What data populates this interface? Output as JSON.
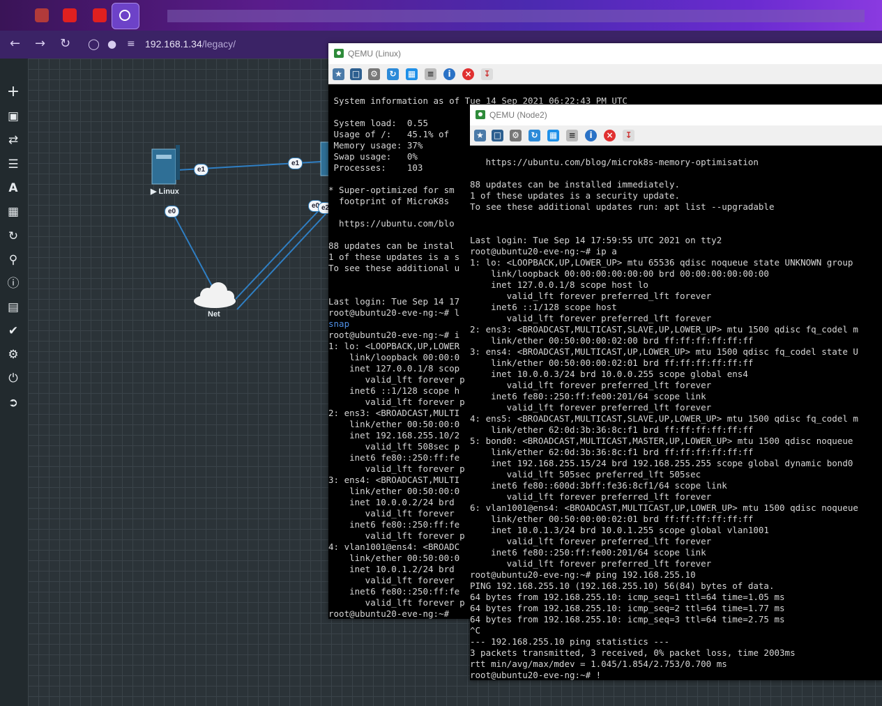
{
  "browser": {
    "url_host": "192.168.1.34",
    "url_path": "/legacy/"
  },
  "sidebar": {
    "icons": [
      "add-icon",
      "node-icon",
      "network-icon",
      "list-icon",
      "text-icon",
      "grid-icon",
      "refresh-icon",
      "zoom-icon",
      "info-icon",
      "table-icon",
      "check-icon",
      "settings-icon",
      "power-icon",
      "logout-icon"
    ]
  },
  "topology": {
    "linux_label": "Linux",
    "net_label": "Net",
    "ports": {
      "linux_e1": "e1",
      "linux_e0": "e0",
      "node2_e1": "e1",
      "node2_e0": "e0",
      "node2_e2": "e2"
    }
  },
  "win_linux": {
    "title": "QEMU (Linux)",
    "lines": [
      "",
      " System information as of Tue 14 Sep 2021 06:22:43 PM UTC",
      "",
      " System load:  0.55",
      " Usage of /:   45.1% of",
      " Memory usage: 37%",
      " Swap usage:   0%",
      " Processes:    103",
      "",
      "* Super-optimized for sm",
      "  footprint of MicroK8s",
      "",
      "  https://ubuntu.com/blo",
      "",
      "88 updates can be instal",
      "1 of these updates is a s",
      "To see these additional u",
      "",
      "",
      "Last login: Tue Sep 14 17",
      "root@ubuntu20-eve-ng:~# l",
      "snap",
      "root@ubuntu20-eve-ng:~# i",
      "1: lo: <LOOPBACK,UP,LOWER",
      "    link/loopback 00:00:0",
      "    inet 127.0.0.1/8 scop",
      "       valid_lft forever p",
      "    inet6 ::1/128 scope h",
      "       valid_lft forever p",
      "2: ens3: <BROADCAST,MULTI",
      "    link/ether 00:50:00:0",
      "    inet 192.168.255.10/2",
      "       valid_lft 508sec p",
      "    inet6 fe80::250:ff:fe",
      "       valid_lft forever p",
      "3: ens4: <BROADCAST,MULTI",
      "    link/ether 00:50:00:0",
      "    inet 10.0.0.2/24 brd",
      "       valid_lft forever",
      "    inet6 fe80::250:ff:fe",
      "       valid_lft forever p",
      "4: vlan1001@ens4: <BROADC",
      "    link/ether 00:50:00:0",
      "    inet 10.0.1.2/24 brd",
      "       valid_lft forever",
      "    inet6 fe80::250:ff:fe",
      "       valid_lft forever p",
      "root@ubuntu20-eve-ng:~# "
    ]
  },
  "win_node2": {
    "title": "QEMU (Node2)",
    "lines": [
      "",
      "   https://ubuntu.com/blog/microk8s-memory-optimisation",
      "",
      "88 updates can be installed immediately.",
      "1 of these updates is a security update.",
      "To see these additional updates run: apt list --upgradable",
      "",
      "",
      "Last login: Tue Sep 14 17:59:55 UTC 2021 on tty2",
      "root@ubuntu20-eve-ng:~# ip a",
      "1: lo: <LOOPBACK,UP,LOWER_UP> mtu 65536 qdisc noqueue state UNKNOWN group",
      "    link/loopback 00:00:00:00:00:00 brd 00:00:00:00:00:00",
      "    inet 127.0.0.1/8 scope host lo",
      "       valid_lft forever preferred_lft forever",
      "    inet6 ::1/128 scope host",
      "       valid_lft forever preferred_lft forever",
      "2: ens3: <BROADCAST,MULTICAST,SLAVE,UP,LOWER_UP> mtu 1500 qdisc fq_codel m",
      "    link/ether 00:50:00:00:02:00 brd ff:ff:ff:ff:ff:ff",
      "3: ens4: <BROADCAST,MULTICAST,UP,LOWER_UP> mtu 1500 qdisc fq_codel state U",
      "    link/ether 00:50:00:00:02:01 brd ff:ff:ff:ff:ff:ff",
      "    inet 10.0.0.3/24 brd 10.0.0.255 scope global ens4",
      "       valid_lft forever preferred_lft forever",
      "    inet6 fe80::250:ff:fe00:201/64 scope link",
      "       valid_lft forever preferred_lft forever",
      "4: ens5: <BROADCAST,MULTICAST,SLAVE,UP,LOWER_UP> mtu 1500 qdisc fq_codel m",
      "    link/ether 62:0d:3b:36:8c:f1 brd ff:ff:ff:ff:ff:ff",
      "5: bond0: <BROADCAST,MULTICAST,MASTER,UP,LOWER_UP> mtu 1500 qdisc noqueue",
      "    link/ether 62:0d:3b:36:8c:f1 brd ff:ff:ff:ff:ff:ff",
      "    inet 192.168.255.15/24 brd 192.168.255.255 scope global dynamic bond0",
      "       valid_lft 505sec preferred_lft 505sec",
      "    inet6 fe80::600d:3bff:fe36:8cf1/64 scope link",
      "       valid_lft forever preferred_lft forever",
      "6: vlan1001@ens4: <BROADCAST,MULTICAST,UP,LOWER_UP> mtu 1500 qdisc noqueue",
      "    link/ether 00:50:00:00:02:01 brd ff:ff:ff:ff:ff:ff",
      "    inet 10.0.1.3/24 brd 10.0.1.255 scope global vlan1001",
      "       valid_lft forever preferred_lft forever",
      "    inet6 fe80::250:ff:fe00:201/64 scope link",
      "       valid_lft forever preferred_lft forever",
      "root@ubuntu20-eve-ng:~# ping 192.168.255.10",
      "PING 192.168.255.10 (192.168.255.10) 56(84) bytes of data.",
      "64 bytes from 192.168.255.10: icmp_seq=1 ttl=64 time=1.05 ms",
      "64 bytes from 192.168.255.10: icmp_seq=2 ttl=64 time=1.77 ms",
      "64 bytes from 192.168.255.10: icmp_seq=3 ttl=64 time=2.75 ms",
      "^C",
      "--- 192.168.255.10 ping statistics ---",
      "3 packets transmitted, 3 received, 0% packet loss, time 2003ms",
      "rtt min/avg/max/mdev = 1.045/1.854/2.753/0.700 ms",
      "root@ubuntu20-eve-ng:~# !"
    ]
  }
}
